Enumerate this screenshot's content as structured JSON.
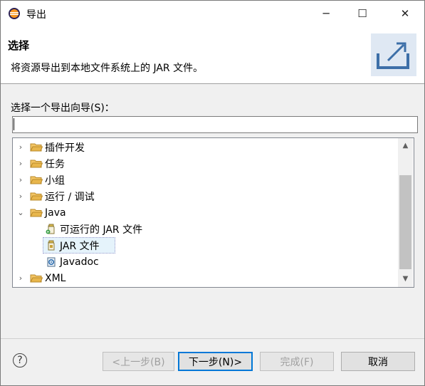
{
  "window": {
    "title": "导出",
    "minimize_glyph": "─",
    "maximize_glyph": "☐",
    "close_glyph": "✕"
  },
  "header": {
    "title": "选择",
    "description": "将资源导出到本地文件系统上的 JAR 文件。",
    "graphic_icon": "export-wizard-icon"
  },
  "wizard": {
    "label": "选择一个导出向导(S)：",
    "filter_value": "",
    "items": [
      {
        "label": "插件开发",
        "type": "folder",
        "expanded": false
      },
      {
        "label": "任务",
        "type": "folder",
        "expanded": false
      },
      {
        "label": "小组",
        "type": "folder",
        "expanded": false
      },
      {
        "label": "运行 / 调试",
        "type": "folder",
        "expanded": false
      },
      {
        "label": "Java",
        "type": "folder",
        "expanded": true
      },
      {
        "label": "可运行的 JAR 文件",
        "type": "leaf",
        "icon": "runnable-jar-icon"
      },
      {
        "label": "JAR 文件",
        "type": "leaf",
        "icon": "jar-icon",
        "selected": true
      },
      {
        "label": "Javadoc",
        "type": "leaf",
        "icon": "javadoc-icon"
      },
      {
        "label": "XML",
        "type": "folder",
        "expanded": false
      }
    ]
  },
  "buttons": {
    "help": "?",
    "back": "<上一步(B)",
    "next": "下一步(N)>",
    "finish": "完成(F)",
    "cancel": "取消"
  },
  "colors": {
    "selection": "#e5f3fb",
    "default_button_border": "#0078d7",
    "folder": "#e8b64c"
  }
}
